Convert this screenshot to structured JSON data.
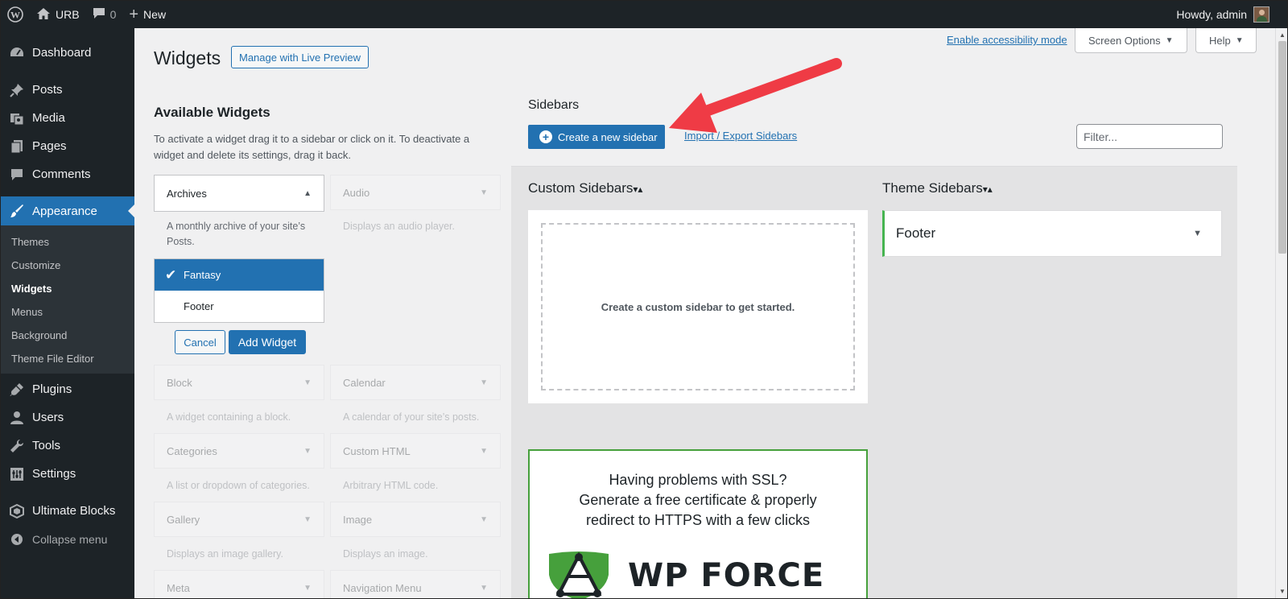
{
  "adminbar": {
    "site_name": "URB",
    "comments_count": "0",
    "new_label": "New",
    "howdy": "Howdy, admin"
  },
  "sidebar": {
    "items_top": [
      {
        "label": "Dashboard",
        "icon": "dashboard-icon"
      },
      {
        "label": "Posts",
        "icon": "pin-icon"
      },
      {
        "label": "Media",
        "icon": "media-icon"
      },
      {
        "label": "Pages",
        "icon": "pages-icon"
      },
      {
        "label": "Comments",
        "icon": "comment-icon"
      }
    ],
    "current": {
      "label": "Appearance",
      "icon": "brush-icon"
    },
    "submenu": [
      "Themes",
      "Customize",
      "Widgets",
      "Menus",
      "Background",
      "Theme File Editor"
    ],
    "submenu_active": "Widgets",
    "items_bottom": [
      {
        "label": "Plugins",
        "icon": "plugin-icon"
      },
      {
        "label": "Users",
        "icon": "user-icon"
      },
      {
        "label": "Tools",
        "icon": "wrench-icon"
      },
      {
        "label": "Settings",
        "icon": "settings-icon"
      }
    ],
    "ultimate_blocks": "Ultimate Blocks",
    "collapse": "Collapse menu"
  },
  "header": {
    "title": "Widgets",
    "live_preview": "Manage with Live Preview",
    "accessibility": "Enable accessibility mode",
    "screen_options": "Screen Options",
    "help": "Help"
  },
  "available": {
    "title": "Available Widgets",
    "description": "To activate a widget drag it to a sidebar or click on it. To deactivate a widget and delete its settings, drag it back.",
    "archives": {
      "name": "Archives",
      "desc": "A monthly archive of your site’s Posts."
    },
    "audio": {
      "name": "Audio",
      "desc": "Displays an audio player."
    },
    "chooser": [
      "Fantasy",
      "Footer"
    ],
    "cancel": "Cancel",
    "add_widget": "Add Widget",
    "rows": [
      {
        "left": {
          "name": "Block",
          "desc": "A widget containing a block."
        },
        "right": {
          "name": "Calendar",
          "desc": "A calendar of your site’s posts."
        }
      },
      {
        "left": {
          "name": "Categories",
          "desc": "A list or dropdown of categories."
        },
        "right": {
          "name": "Custom HTML",
          "desc": "Arbitrary HTML code."
        }
      },
      {
        "left": {
          "name": "Gallery",
          "desc": "Displays an image gallery."
        },
        "right": {
          "name": "Image",
          "desc": "Displays an image."
        }
      },
      {
        "left": {
          "name": "Meta",
          "desc": ""
        },
        "right": {
          "name": "Navigation Menu",
          "desc": ""
        }
      }
    ]
  },
  "sidebars": {
    "title": "Sidebars",
    "create_button": "Create a new sidebar",
    "import_export": "Import / Export Sidebars",
    "filter_placeholder": "Filter...",
    "custom_title": "Custom Sidebars",
    "custom_empty": "Create a custom sidebar to get started.",
    "theme_title": "Theme Sidebars",
    "theme_items": [
      "Footer"
    ],
    "sort_glyph": "▾▴"
  },
  "promo": {
    "line1": "Having problems with SSL?",
    "line2": "Generate a free certificate & properly",
    "line3": "redirect to HTTPS with a few clicks",
    "brand": "WP FORCE"
  },
  "colors": {
    "admin_dark": "#1d2327",
    "accent_blue": "#2271b1",
    "success_green": "#46b450",
    "annotation_red": "#ef3b45"
  }
}
